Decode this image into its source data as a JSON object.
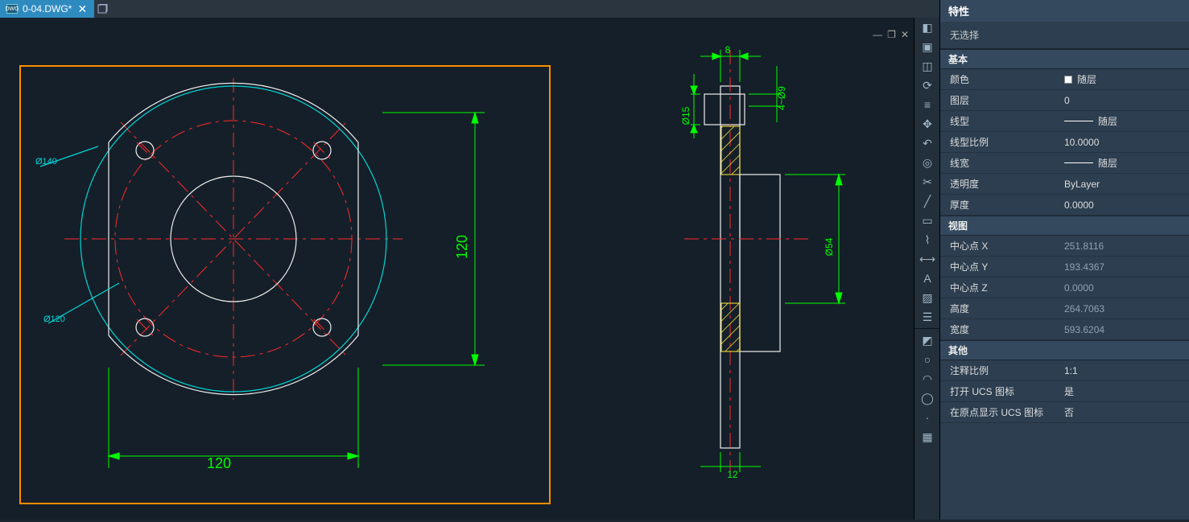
{
  "tab": {
    "title": "0-04.DWG*",
    "iconText": "DWG"
  },
  "window_controls": {
    "min": "—",
    "max": "❐",
    "close": "✕"
  },
  "palette_tools": [
    "eraser-icon",
    "select-icon",
    "mirror-icon",
    "rotate-icon",
    "align-icon",
    "move-icon",
    "undo-icon",
    "offset-icon",
    "trim-icon",
    "line-icon",
    "rect-icon",
    "polyline-icon",
    "dimension-icon",
    "text-icon",
    "hatch-icon",
    "layer-icon"
  ],
  "palette_tools2": [
    "block-icon",
    "circle-icon",
    "arc-icon",
    "ellipse-icon",
    "point-icon",
    "region-icon"
  ],
  "properties": {
    "title": "特性",
    "no_selection": "无选择",
    "sections": {
      "basic": {
        "header": "基本",
        "rows": [
          {
            "label": "颜色",
            "value": "随层",
            "swatch": true
          },
          {
            "label": "图层",
            "value": "0"
          },
          {
            "label": "线型",
            "value": "随层",
            "line": true
          },
          {
            "label": "线型比例",
            "value": "10.0000"
          },
          {
            "label": "线宽",
            "value": "随层",
            "line": true
          },
          {
            "label": "透明度",
            "value": "ByLayer"
          },
          {
            "label": "厚度",
            "value": "0.0000"
          }
        ]
      },
      "view": {
        "header": "视图",
        "rows": [
          {
            "label": "中心点 X",
            "value": "251.8116",
            "dim": true
          },
          {
            "label": "中心点 Y",
            "value": "193.4367",
            "dim": true
          },
          {
            "label": "中心点 Z",
            "value": "0.0000",
            "dim": true
          },
          {
            "label": "高度",
            "value": "264.7063",
            "dim": true
          },
          {
            "label": "宽度",
            "value": "593.6204",
            "dim": true
          }
        ]
      },
      "other": {
        "header": "其他",
        "rows": [
          {
            "label": "注释比例",
            "value": "1:1"
          },
          {
            "label": "打开 UCS 图标",
            "value": "是"
          },
          {
            "label": "在原点显示 UCS 图标",
            "value": "否"
          }
        ]
      }
    }
  },
  "drawing": {
    "dims_front": {
      "w": "120",
      "h": "120",
      "d140": "Ø140",
      "d120": "Ø120"
    },
    "dims_side": {
      "top": "8",
      "h15": "Ø15",
      "r4": "4~Ø9",
      "d54": "Ø54",
      "base": "12"
    }
  }
}
